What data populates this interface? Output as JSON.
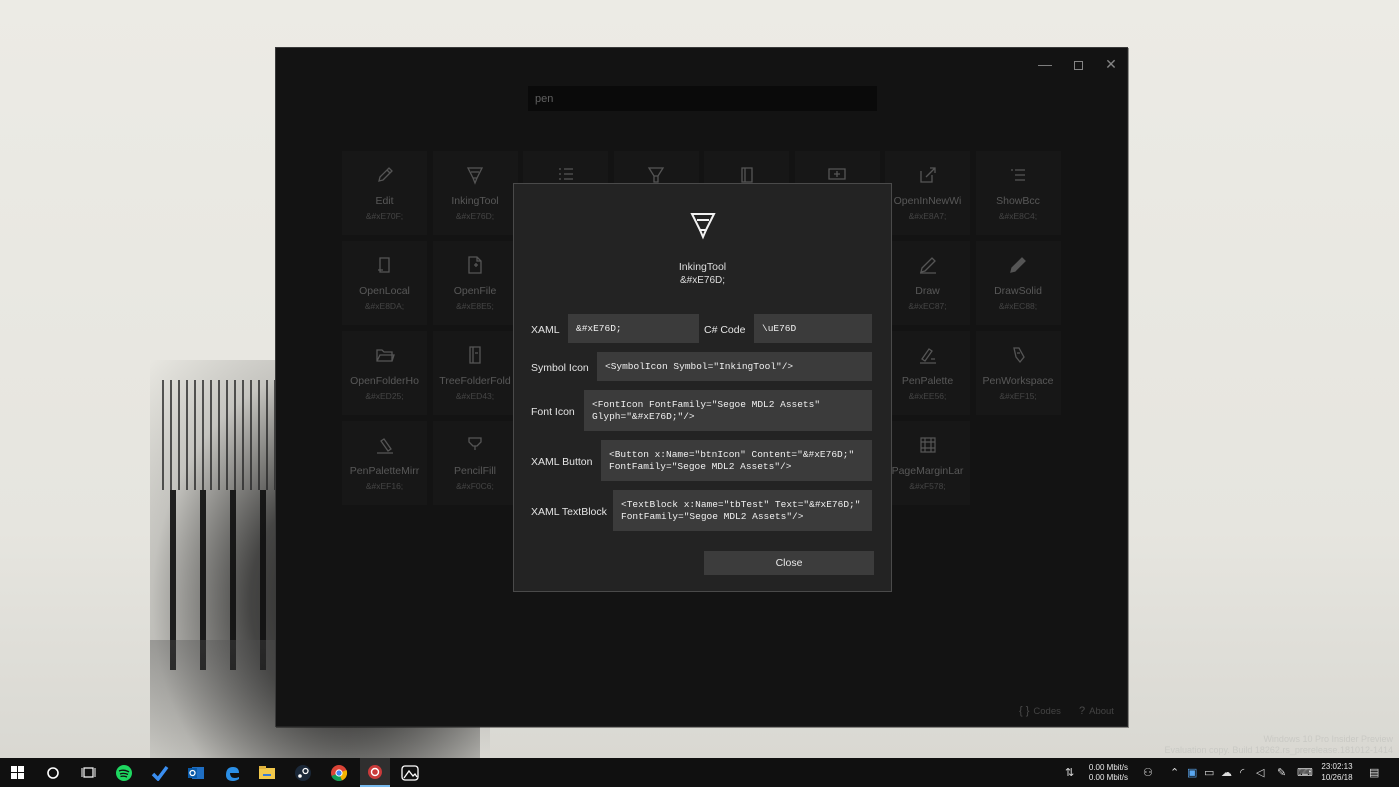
{
  "wallpaper": {
    "watermark_line1": "Windows 10 Pro Insider Preview",
    "watermark_line2": "Evaluation copy. Build 18262.rs_prerelease.181012-1414"
  },
  "window": {
    "caption": {
      "minimize_glyph": "—",
      "close_glyph": "✕"
    },
    "search": {
      "value": "pen"
    },
    "icons": [
      {
        "name": "Edit",
        "code": "&#xE70F;",
        "icon": "pencil-icon"
      },
      {
        "name": "InkingTool",
        "code": "&#xE76D;",
        "icon": "inking-tool-icon"
      },
      {
        "name": "",
        "code": "",
        "icon": "list-icon"
      },
      {
        "name": "",
        "code": "",
        "icon": "highlighter-icon"
      },
      {
        "name": "",
        "code": "",
        "icon": "book-icon"
      },
      {
        "name": "",
        "code": "",
        "icon": "slideshow-icon"
      },
      {
        "name": "OpenInNewWi",
        "code": "&#xE8A7;",
        "icon": "open-in-new-window-icon"
      },
      {
        "name": "ShowBcc",
        "code": "&#xE8C4;",
        "icon": "show-bcc-icon"
      },
      {
        "name": "OpenLocal",
        "code": "&#xE8DA;",
        "icon": "open-local-icon"
      },
      {
        "name": "OpenFile",
        "code": "&#xE8E5;",
        "icon": "open-file-icon"
      },
      {
        "name": "",
        "code": "",
        "icon": ""
      },
      {
        "name": "",
        "code": "",
        "icon": ""
      },
      {
        "name": "",
        "code": "",
        "icon": ""
      },
      {
        "name": "",
        "code": "",
        "icon": ""
      },
      {
        "name": "Draw",
        "code": "&#xEC87;",
        "icon": "draw-icon"
      },
      {
        "name": "DrawSolid",
        "code": "&#xEC88;",
        "icon": "draw-solid-icon"
      },
      {
        "name": "OpenFolderHo",
        "code": "&#xED25;",
        "icon": "open-folder-icon"
      },
      {
        "name": "TreeFolderFold",
        "code": "&#xED43;",
        "icon": "tree-folder-icon"
      },
      {
        "name": "",
        "code": "",
        "icon": ""
      },
      {
        "name": "",
        "code": "",
        "icon": ""
      },
      {
        "name": "",
        "code": "",
        "icon": ""
      },
      {
        "name": "",
        "code": "",
        "icon": ""
      },
      {
        "name": "PenPalette",
        "code": "&#xEE56;",
        "icon": "pen-palette-icon"
      },
      {
        "name": "PenWorkspace",
        "code": "&#xEF15;",
        "icon": "pen-workspace-icon"
      },
      {
        "name": "PenPaletteMirr",
        "code": "&#xEF16;",
        "icon": "pen-palette-mirrored-icon"
      },
      {
        "name": "PencilFill",
        "code": "&#xF0C6;",
        "icon": "pencil-fill-icon"
      },
      {
        "name": "",
        "code": "",
        "icon": ""
      },
      {
        "name": "",
        "code": "",
        "icon": ""
      },
      {
        "name": "",
        "code": "",
        "icon": ""
      },
      {
        "name": "",
        "code": "",
        "icon": ""
      },
      {
        "name": "PageMarginLar",
        "code": "&#xF578;",
        "icon": "page-margin-icon"
      }
    ],
    "footer": {
      "codes_glyph": "{ }",
      "codes_label": "Codes",
      "about_glyph": "?",
      "about_label": "About"
    }
  },
  "dialog": {
    "icon": "inking-tool-icon",
    "name": "InkingTool",
    "code": "&#xE76D;",
    "xaml_label": "XAML",
    "xaml_value": "&#xE76D;",
    "csharp_label": "C# Code",
    "csharp_value": "\\uE76D",
    "symbol_icon_label": "Symbol Icon",
    "symbol_icon_value": "<SymbolIcon Symbol=\"InkingTool\"/>",
    "font_icon_label": "Font Icon",
    "font_icon_value": "<FontIcon FontFamily=\"Segoe MDL2 Assets\"\nGlyph=\"&#xE76D;\"/>",
    "xaml_button_label": "XAML Button",
    "xaml_button_value": "<Button x:Name=\"btnIcon\" Content=\"&#xE76D;\"\nFontFamily=\"Segoe MDL2 Assets\"/>",
    "xaml_textblock_label": "XAML TextBlock",
    "xaml_textblock_value": "<TextBlock x:Name=\"tbTest\" Text=\"&#xE76D;\"\nFontFamily=\"Segoe MDL2 Assets\"/>",
    "close_label": "Close"
  },
  "taskbar": {
    "net_up": "0.00 Mbit/s",
    "net_down": "0.00 Mbit/s",
    "time": "23:02:13",
    "date": "10/26/18",
    "apps": [
      "windows-start-icon",
      "cortana-icon",
      "task-view-icon",
      "spotify-icon",
      "todo-icon",
      "outlook-icon",
      "edge-icon",
      "file-explorer-icon",
      "steam-icon",
      "chrome-icon",
      "icon-app-icon",
      "photos-icon"
    ]
  },
  "colors": {
    "window_bg": "#1f1f1f",
    "tile_bg": "#262626",
    "dialog_bg": "#232323",
    "field_bg": "#3b3b3b",
    "taskbar_bg": "#101010",
    "accent": "#0078d7"
  }
}
